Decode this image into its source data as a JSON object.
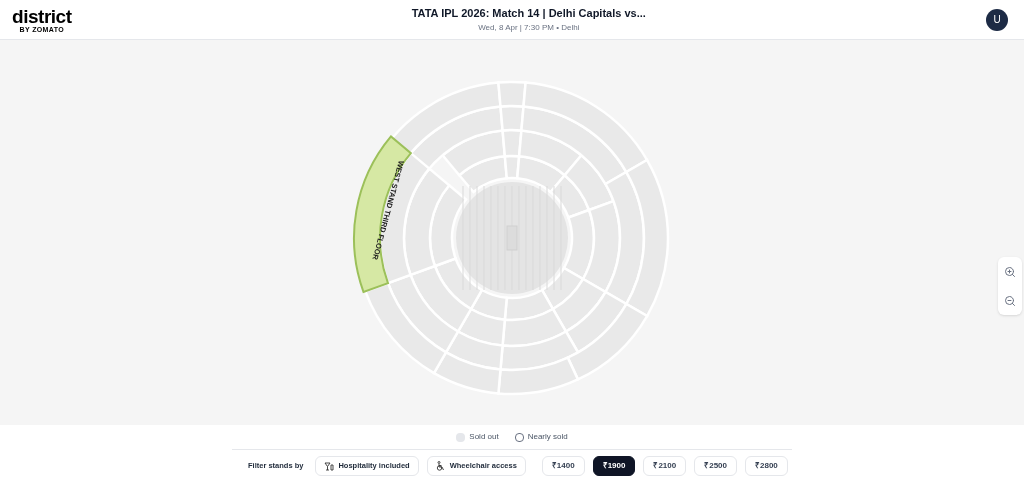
{
  "header": {
    "logo": "district",
    "logo_sub": "BY ZOMATO",
    "title": "TATA IPL 2026: Match 14 | Delhi Capitals vs...",
    "subtitle": "Wed, 8 Apr | 7:30 PM • Delhi",
    "avatar": "U"
  },
  "stands": [
    {
      "label": "WEST STAND THIRD FLOOR",
      "selected": true
    }
  ],
  "legend": [
    {
      "kind": "filled",
      "label": "Sold out"
    },
    {
      "kind": "outline",
      "label": "Nearly sold"
    }
  ],
  "filter": {
    "label": "Filter stands by",
    "chips": [
      {
        "kind": "hospitality",
        "label": "Hospitality included",
        "selected": false
      },
      {
        "kind": "wheelchair",
        "label": "Wheelchair access",
        "selected": false
      }
    ],
    "prices": [
      {
        "label": "₹1400",
        "selected": false
      },
      {
        "label": "₹1900",
        "selected": true
      },
      {
        "label": "₹2100",
        "selected": false
      },
      {
        "label": "₹2500",
        "selected": false
      },
      {
        "label": "₹2800",
        "selected": false
      }
    ]
  }
}
